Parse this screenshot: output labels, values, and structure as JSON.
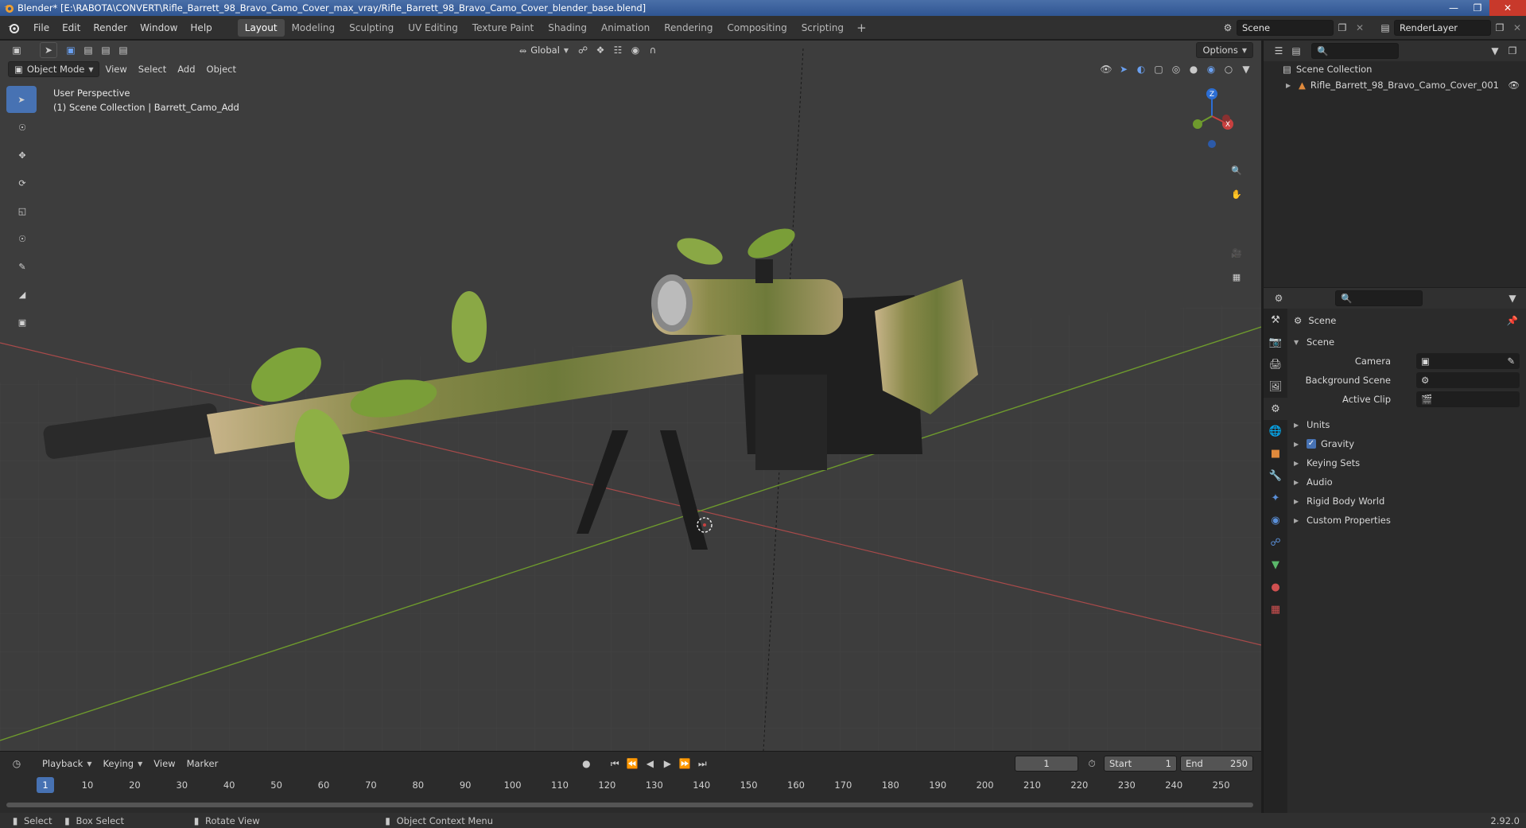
{
  "window": {
    "title": "Blender* [E:\\RABOTA\\CONVERT\\Rifle_Barrett_98_Bravo_Camo_Cover_max_vray/Rifle_Barrett_98_Bravo_Camo_Cover_blender_base.blend]",
    "version": "2.92.0"
  },
  "menu": [
    "File",
    "Edit",
    "Render",
    "Window",
    "Help"
  ],
  "workspaces": [
    "Layout",
    "Modeling",
    "Sculpting",
    "UV Editing",
    "Texture Paint",
    "Shading",
    "Animation",
    "Rendering",
    "Compositing",
    "Scripting"
  ],
  "scene_name": "Scene",
  "render_layer": "RenderLayer",
  "viewport": {
    "mode": "Object Mode",
    "menus": [
      "View",
      "Select",
      "Add",
      "Object"
    ],
    "transform_orientation": "Global",
    "options_label": "Options",
    "info_line1": "User Perspective",
    "info_line2": "(1) Scene Collection | Barrett_Camo_Add",
    "axis_labels": {
      "x": "X",
      "y": "Y",
      "z": "Z"
    }
  },
  "timeline": {
    "menus": [
      "Playback",
      "Keying",
      "View",
      "Marker"
    ],
    "current_frame": "1",
    "start_label": "Start",
    "start": "1",
    "end_label": "End",
    "end": "250",
    "ruler": [
      "10",
      "20",
      "30",
      "40",
      "50",
      "60",
      "70",
      "80",
      "90",
      "100",
      "110",
      "120",
      "130",
      "140",
      "150",
      "160",
      "170",
      "180",
      "190",
      "200",
      "210",
      "220",
      "230",
      "240",
      "250"
    ]
  },
  "status": {
    "select": "Select",
    "box_select": "Box Select",
    "rotate_view": "Rotate View",
    "context_menu": "Object Context Menu"
  },
  "outliner": {
    "root": "Scene Collection",
    "items": [
      "Rifle_Barrett_98_Bravo_Camo_Cover_001"
    ]
  },
  "properties": {
    "context": "Scene",
    "panel": "Scene",
    "fields": [
      {
        "label": "Camera",
        "value": ""
      },
      {
        "label": "Background Scene",
        "value": ""
      },
      {
        "label": "Active Clip",
        "value": ""
      }
    ],
    "sections": [
      "Units",
      "Gravity",
      "Keying Sets",
      "Audio",
      "Rigid Body World",
      "Custom Properties"
    ]
  },
  "colors": {
    "accent": "#4772b3",
    "viewport_bg": "#3d3d3d",
    "x_axis": "#c8403f",
    "y_axis": "#6e9a2d",
    "z_axis": "#2c6ed4"
  }
}
